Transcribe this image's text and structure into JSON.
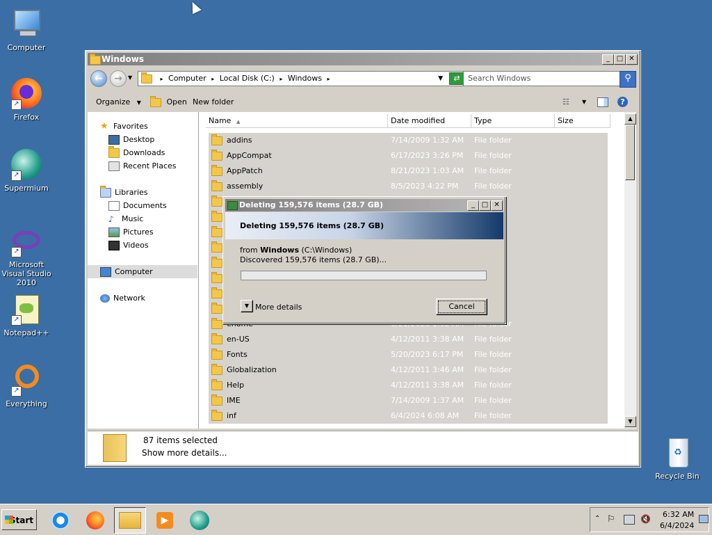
{
  "desktop": {
    "icons": [
      {
        "label": "Computer"
      },
      {
        "label": "Firefox"
      },
      {
        "label": "Supermium"
      },
      {
        "label": "Microsoft Visual Studio 2010"
      },
      {
        "label": "Notepad++"
      },
      {
        "label": "Everything"
      },
      {
        "label": "Recycle Bin"
      }
    ]
  },
  "explorer": {
    "title": "Windows",
    "breadcrumb": [
      "Computer",
      "Local Disk (C:)",
      "Windows"
    ],
    "search_placeholder": "Search Windows",
    "toolbar": {
      "organize": "Organize",
      "open": "Open",
      "new_folder": "New folder"
    },
    "nav": {
      "favorites": "Favorites",
      "desktop": "Desktop",
      "downloads": "Downloads",
      "recent": "Recent Places",
      "libraries": "Libraries",
      "documents": "Documents",
      "music": "Music",
      "pictures": "Pictures",
      "videos": "Videos",
      "computer": "Computer",
      "network": "Network"
    },
    "columns": {
      "name": "Name",
      "date": "Date modified",
      "type": "Type",
      "size": "Size"
    },
    "rows": [
      {
        "name": "addins",
        "date": "7/14/2009 1:32 AM",
        "type": "File folder"
      },
      {
        "name": "AppCompat",
        "date": "6/17/2023 3:26 PM",
        "type": "File folder"
      },
      {
        "name": "AppPatch",
        "date": "8/21/2023 1:03 AM",
        "type": "File folder"
      },
      {
        "name": "assembly",
        "date": "8/5/2023 4:22 PM",
        "type": "File folder"
      },
      {
        "name": "",
        "date": "",
        "type": ""
      },
      {
        "name": "",
        "date": "",
        "type": ""
      },
      {
        "name": "",
        "date": "",
        "type": ""
      },
      {
        "name": "",
        "date": "",
        "type": ""
      },
      {
        "name": "",
        "date": "",
        "type": ""
      },
      {
        "name": "",
        "date": "",
        "type": ""
      },
      {
        "name": "",
        "date": "",
        "type": ""
      },
      {
        "name": "",
        "date": "",
        "type": ""
      },
      {
        "name": "ehome",
        "date": "6/21/2023 1:02 AM",
        "type": "File folder"
      },
      {
        "name": "en-US",
        "date": "4/12/2011 3:38 AM",
        "type": "File folder"
      },
      {
        "name": "Fonts",
        "date": "5/20/2023 6:17 PM",
        "type": "File folder"
      },
      {
        "name": "Globalization",
        "date": "4/12/2011 3:46 AM",
        "type": "File folder"
      },
      {
        "name": "Help",
        "date": "4/12/2011 3:38 AM",
        "type": "File folder"
      },
      {
        "name": "IME",
        "date": "7/14/2009 1:37 AM",
        "type": "File folder"
      },
      {
        "name": "inf",
        "date": "6/4/2024 6:08 AM",
        "type": "File folder"
      }
    ],
    "details": {
      "selected": "87 items selected",
      "more": "Show more details..."
    }
  },
  "dialog": {
    "title": "Deleting 159,576 items (28.7 GB)",
    "heading": "Deleting 159,576 items (28.7 GB)",
    "from_prefix": "from",
    "from_name": "Windows",
    "from_path": "(C:\\Windows)",
    "discovered": "Discovered 159,576 items (28.7 GB)...",
    "more_details": "More details",
    "cancel": "Cancel",
    "progress": 0
  },
  "taskbar": {
    "start": "Start",
    "time": "6:32 AM",
    "date": "6/4/2024"
  }
}
